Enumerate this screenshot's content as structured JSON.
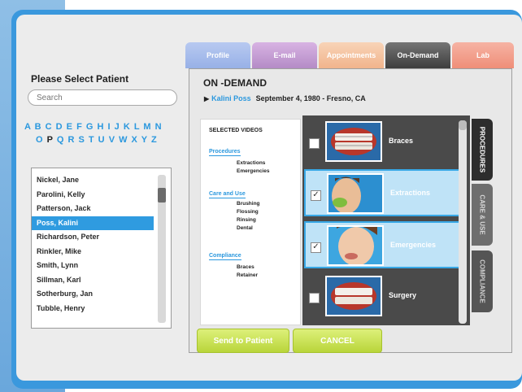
{
  "patient_panel": {
    "title": "Please Select Patient",
    "search_placeholder": "Search",
    "alphabet_row1": [
      "A",
      "B",
      "C",
      "D",
      "E",
      "F",
      "G",
      "H",
      "I",
      "J",
      "K",
      "L",
      "M",
      "N"
    ],
    "alphabet_row2": [
      "O",
      "P",
      "Q",
      "R",
      "S",
      "T",
      "U",
      "V",
      "W",
      "X",
      "Y",
      "Z"
    ],
    "alphabet_selected": "P",
    "patients": [
      "Nickel, Jane",
      "Parolini, Kelly",
      "Patterson, Jack",
      "Poss, Kalini",
      "Richardson, Peter",
      "Rinkler, Mike",
      "Smith, Lynn",
      "Sillman, Karl",
      "Sotherburg, Jan",
      "Tubble, Henry"
    ],
    "selected_patient": "Poss, Kalini"
  },
  "tabs": {
    "profile": "Profile",
    "email": "E-mail",
    "appointments": "Appointments",
    "on_demand": "On-Demand",
    "lab": "Lab"
  },
  "ondemand": {
    "title": "ON -DEMAND",
    "patient_name": "Kalini Poss",
    "patient_details": "September 4, 1980 - Fresno, CA",
    "selected_videos_heading": "SELECTED VIDEOS",
    "sections": [
      {
        "name": "Procedures",
        "items": [
          "Extractions",
          "Emergencies"
        ]
      },
      {
        "name": "Care and Use",
        "items": [
          "Brushing",
          "Flossing",
          "Rinsing",
          "Dental"
        ]
      },
      {
        "name": "Compliance",
        "items": [
          "Braces",
          "Retainer"
        ]
      }
    ],
    "videos": [
      {
        "label": "Braces",
        "checked": false,
        "selected": false,
        "check": ""
      },
      {
        "label": "Extractions",
        "checked": true,
        "selected": true,
        "check": "✓"
      },
      {
        "label": "Emergencies",
        "checked": true,
        "selected": true,
        "check": "✓"
      },
      {
        "label": "Surgery",
        "checked": false,
        "selected": false,
        "check": ""
      }
    ],
    "side_tabs": [
      "PROCEDURES",
      "CARE & USE",
      "COMPLIANCE"
    ]
  },
  "buttons": {
    "send": "Send to Patient",
    "cancel": "CANCEL"
  },
  "colors": {
    "accent": "#2b98de",
    "button": "#c5df4f"
  }
}
